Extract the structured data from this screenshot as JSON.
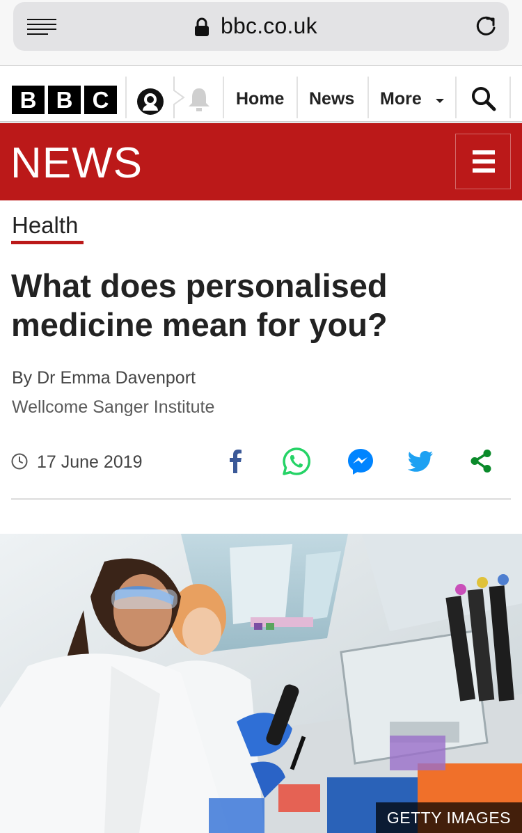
{
  "browser": {
    "url": "bbc.co.uk"
  },
  "global_nav": {
    "logo_letters": [
      "B",
      "B",
      "C"
    ],
    "links": [
      "Home",
      "News",
      "More"
    ]
  },
  "banner": {
    "title": "NEWS"
  },
  "article": {
    "section": "Health",
    "headline": "What does personalised medicine mean for you?",
    "byline": "By Dr Emma Davenport",
    "organisation": "Wellcome Sanger Institute",
    "date": "17 June 2019",
    "share_icons": [
      "facebook-icon",
      "whatsapp-icon",
      "messenger-icon",
      "twitter-icon",
      "share-icon"
    ],
    "image_credit": "GETTY IMAGES"
  },
  "colors": {
    "bbc_red": "#bb1919",
    "facebook": "#3b5998",
    "whatsapp": "#25d366",
    "messenger": "#0084ff",
    "twitter": "#1da1f2",
    "share": "#0a8a2a"
  }
}
